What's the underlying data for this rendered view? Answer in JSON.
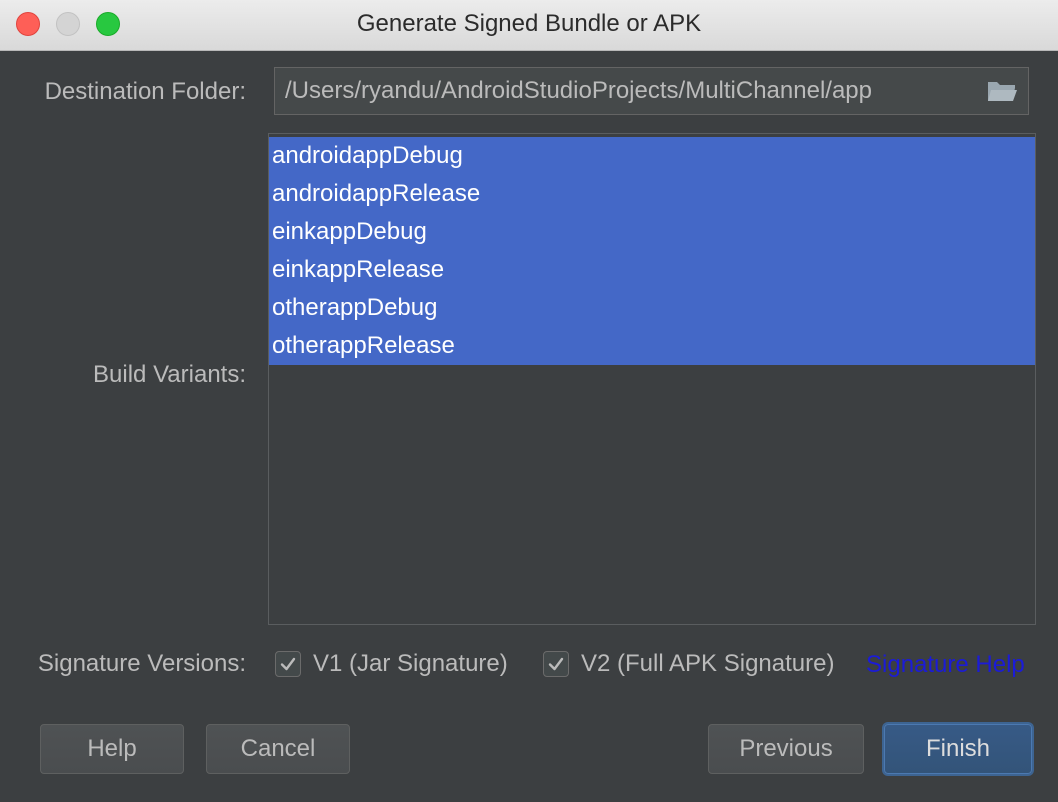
{
  "window": {
    "title": "Generate Signed Bundle or APK"
  },
  "destination": {
    "label": "Destination Folder:",
    "value": "/Users/ryandu/AndroidStudioProjects/MultiChannel/app",
    "icon": "folder-icon"
  },
  "build_variants": {
    "label": "Build Variants:",
    "items": [
      {
        "label": "androidappDebug",
        "selected": true
      },
      {
        "label": "androidappRelease",
        "selected": true
      },
      {
        "label": "einkappDebug",
        "selected": true
      },
      {
        "label": "einkappRelease",
        "selected": true
      },
      {
        "label": "otherappDebug",
        "selected": true
      },
      {
        "label": "otherappRelease",
        "selected": true
      }
    ]
  },
  "signature": {
    "label": "Signature Versions:",
    "v1_label": "V1 (Jar Signature)",
    "v1_checked": true,
    "v2_label": "V2 (Full APK Signature)",
    "v2_checked": true,
    "help_link": "Signature Help"
  },
  "buttons": {
    "help": "Help",
    "cancel": "Cancel",
    "previous": "Previous",
    "finish": "Finish"
  },
  "colors": {
    "background": "#3c3f41",
    "selection": "#4468c7",
    "link": "#1b1bd7",
    "primary_button": "#365880"
  }
}
